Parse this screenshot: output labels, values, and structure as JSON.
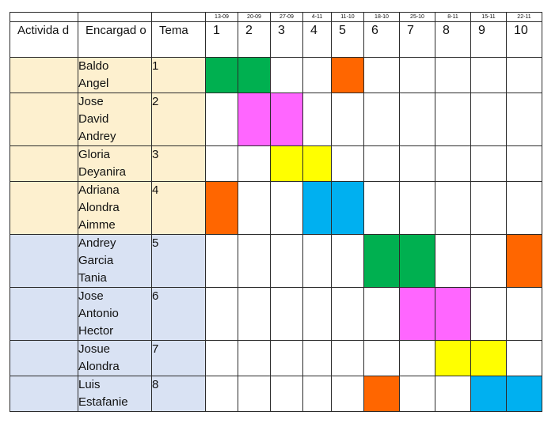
{
  "dates": [
    "",
    "",
    "",
    "13-09",
    "20-09",
    "27-09",
    "4-11",
    "11-10",
    "18-10",
    "25-10",
    "8-11",
    "15-11",
    "22-11"
  ],
  "headers": {
    "activity": "Activida d",
    "manager": "Encargad o",
    "topic": "Tema",
    "weeks": [
      "1",
      "2",
      "3",
      "4",
      "5",
      "6",
      "7",
      "8",
      "9",
      "10"
    ]
  },
  "colors": {
    "green": "#00b050",
    "orange": "#ff6600",
    "pink": "#ff66ff",
    "yellow": "#ffff00",
    "blue": "#00b0f0",
    "group1": "#fdf0cf",
    "group2": "#d9e2f3"
  },
  "rows": [
    {
      "group": 1,
      "names": [
        "Baldo",
        "Angel"
      ],
      "topic": "1",
      "cells": [
        "green",
        "green",
        "",
        "",
        "orange",
        "",
        "",
        "",
        "",
        ""
      ]
    },
    {
      "group": 1,
      "names": [
        "Jose",
        "David",
        "Andrey"
      ],
      "topic": "2",
      "cells": [
        "",
        "pink",
        "pink",
        "",
        "",
        "",
        "",
        "",
        "",
        ""
      ]
    },
    {
      "group": 1,
      "names": [
        "Gloria",
        "Deyanira"
      ],
      "topic": "3",
      "cells": [
        "",
        "",
        "yellow",
        "yellow",
        "",
        "",
        "",
        "",
        "",
        ""
      ]
    },
    {
      "group": 1,
      "names": [
        "Adriana",
        "Alondra",
        "Aimme"
      ],
      "topic": "4",
      "cells": [
        "orange",
        "",
        "",
        "blue",
        "blue",
        "",
        "",
        "",
        "",
        ""
      ]
    },
    {
      "group": 2,
      "names": [
        "Andrey",
        "Garcia",
        "Tania"
      ],
      "topic": "5",
      "cells": [
        "",
        "",
        "",
        "",
        "",
        "green",
        "green",
        "",
        "",
        "orange"
      ]
    },
    {
      "group": 2,
      "names": [
        "Jose",
        "Antonio",
        "Hector"
      ],
      "topic": "6",
      "cells": [
        "",
        "",
        "",
        "",
        "",
        "",
        "pink",
        "pink",
        "",
        ""
      ]
    },
    {
      "group": 2,
      "names": [
        "Josue",
        "Alondra"
      ],
      "topic": "7",
      "cells": [
        "",
        "",
        "",
        "",
        "",
        "",
        "",
        "yellow",
        "yellow",
        ""
      ]
    },
    {
      "group": 2,
      "names": [
        "Luis",
        "Estafanie"
      ],
      "topic": "8",
      "cells": [
        "",
        "",
        "",
        "",
        "",
        "orange",
        "",
        "",
        "blue",
        "blue"
      ]
    }
  ]
}
